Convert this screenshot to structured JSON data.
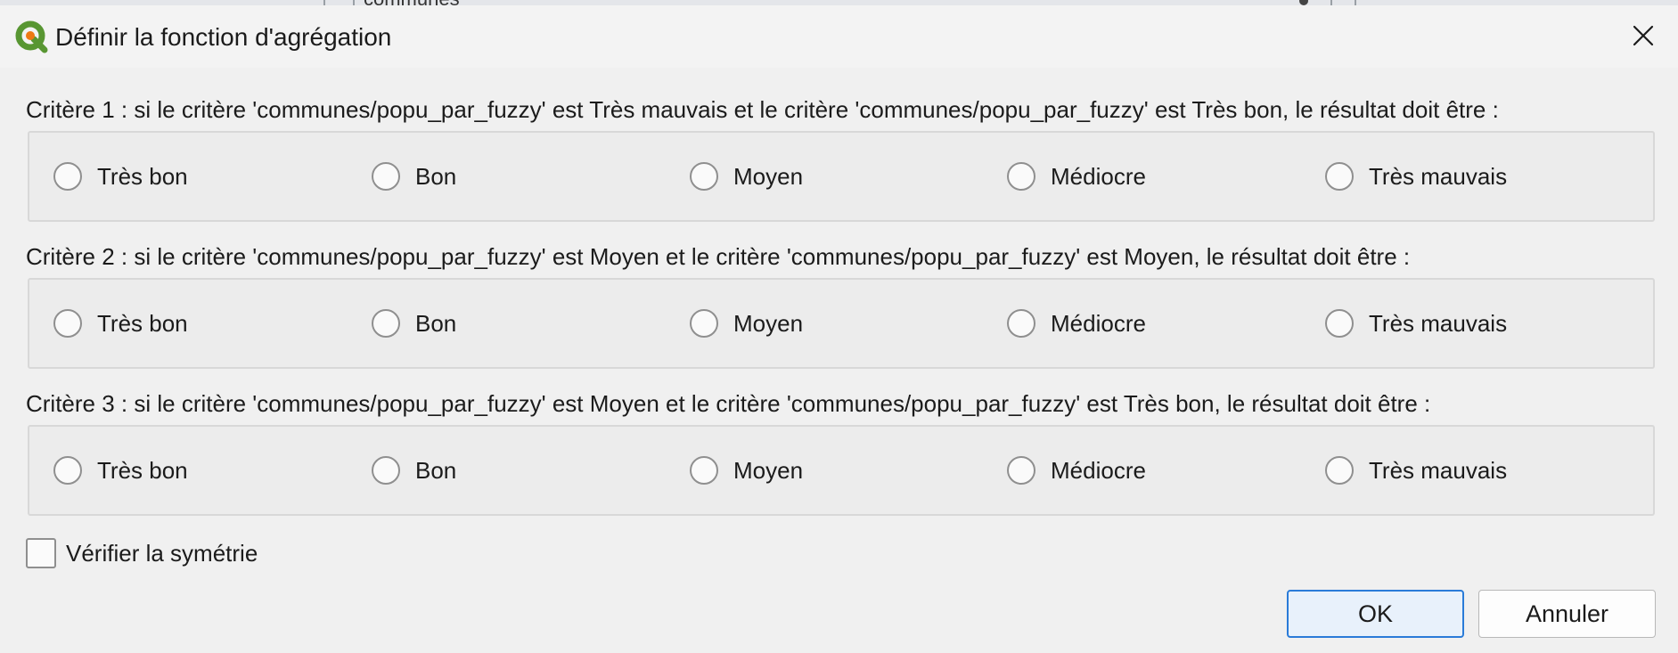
{
  "window": {
    "title": "Définir la fonction d'agrégation",
    "background_fragment": "communes"
  },
  "criteria": [
    {
      "label": "Critère 1 : si le critère 'communes/popu_par_fuzzy' est Très mauvais et le critère 'communes/popu_par_fuzzy' est Très bon, le résultat doit être :",
      "options": [
        "Très bon",
        "Bon",
        "Moyen",
        "Médiocre",
        "Très mauvais"
      ],
      "selected": null
    },
    {
      "label": "Critère 2 : si le critère 'communes/popu_par_fuzzy' est Moyen et le critère 'communes/popu_par_fuzzy' est Moyen, le résultat doit être :",
      "options": [
        "Très bon",
        "Bon",
        "Moyen",
        "Médiocre",
        "Très mauvais"
      ],
      "selected": null
    },
    {
      "label": "Critère 3 : si le critère 'communes/popu_par_fuzzy' est Moyen et le critère 'communes/popu_par_fuzzy' est Très bon, le résultat doit être :",
      "options": [
        "Très bon",
        "Bon",
        "Moyen",
        "Médiocre",
        "Très mauvais"
      ],
      "selected": null
    }
  ],
  "symmetry": {
    "label": "Vérifier la symétrie",
    "checked": false
  },
  "buttons": {
    "ok": "OK",
    "cancel": "Annuler"
  },
  "colors": {
    "accent": "#2a7bd8",
    "qgis_green": "#589632",
    "qgis_yellow": "#ee7913"
  },
  "icons": {
    "app": "qgis-logo-icon",
    "close": "close-icon"
  }
}
